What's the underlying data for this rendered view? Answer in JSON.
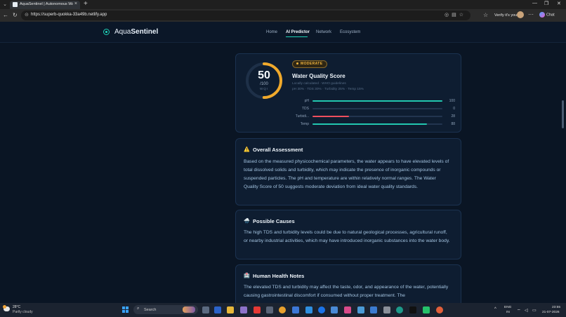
{
  "browser": {
    "tab_title": "AquaSentinel | Autonomous Wat...",
    "url": "https://superb-quokka-33a49b.netlify.app",
    "profile_label": "Verify it's you",
    "chat_label": "Chat"
  },
  "site": {
    "brand_prefix": "Aqua",
    "brand_suffix": "Sentinel",
    "nav": [
      "Home",
      "AI Predictor",
      "Network",
      "Ecosystem"
    ],
    "active_nav": "AI Predictor"
  },
  "score_card": {
    "score": "50",
    "score_value": 50,
    "score_max": 100,
    "denominator": "/100",
    "gauge_caption": "WQI",
    "badge": "MODERATE",
    "title": "Water Quality Score",
    "note": "Locally calculated · WHO guidelines",
    "weights": "pH 30% · TDS 30% · Turbidity 25% · Temp 15%",
    "accent_color": "#f0a92b",
    "bars": [
      {
        "label": "pH",
        "value": 100,
        "display": "100",
        "color": "#22c7b0"
      },
      {
        "label": "TDS",
        "value": 0,
        "display": "0",
        "color": "#22c7b0"
      },
      {
        "label": "Turbidi...",
        "value": 28,
        "display": "28",
        "color": "#ef4f5e"
      },
      {
        "label": "Temp",
        "value": 88,
        "display": "88",
        "color": "#22c7b0"
      }
    ]
  },
  "sections": [
    {
      "icon": "warning-icon",
      "glyph": "⚠️",
      "title": "Overall Assessment",
      "body": "Based on the measured physicochemical parameters, the water appears to have elevated levels of total dissolved solids and turbidity, which may indicate the presence of inorganic compounds or suspended particles. The pH and temperature are within relatively normal ranges. The Water Quality Score of 50 suggests moderate deviation from ideal water quality standards."
    },
    {
      "icon": "storm-icon",
      "glyph": "🌧️",
      "title": "Possible Causes",
      "body": "The high TDS and turbidity levels could be due to natural geological processes, agricultural runoff, or nearby industrial activities, which may have introduced inorganic substances into the water body."
    },
    {
      "icon": "health-icon",
      "glyph": "🏥",
      "title": "Human Health Notes",
      "body": "The elevated TDS and turbidity may affect the taste, odor, and appearance of the water, potentially causing gastrointestinal discomfort if consumed without proper treatment. The"
    }
  ],
  "taskbar": {
    "temperature": "28°C",
    "weather": "Partly cloudy",
    "search_placeholder": "Search",
    "lang_top": "ENG",
    "lang_bottom": "IN",
    "time": "23:55",
    "date": "21-07-2026"
  }
}
